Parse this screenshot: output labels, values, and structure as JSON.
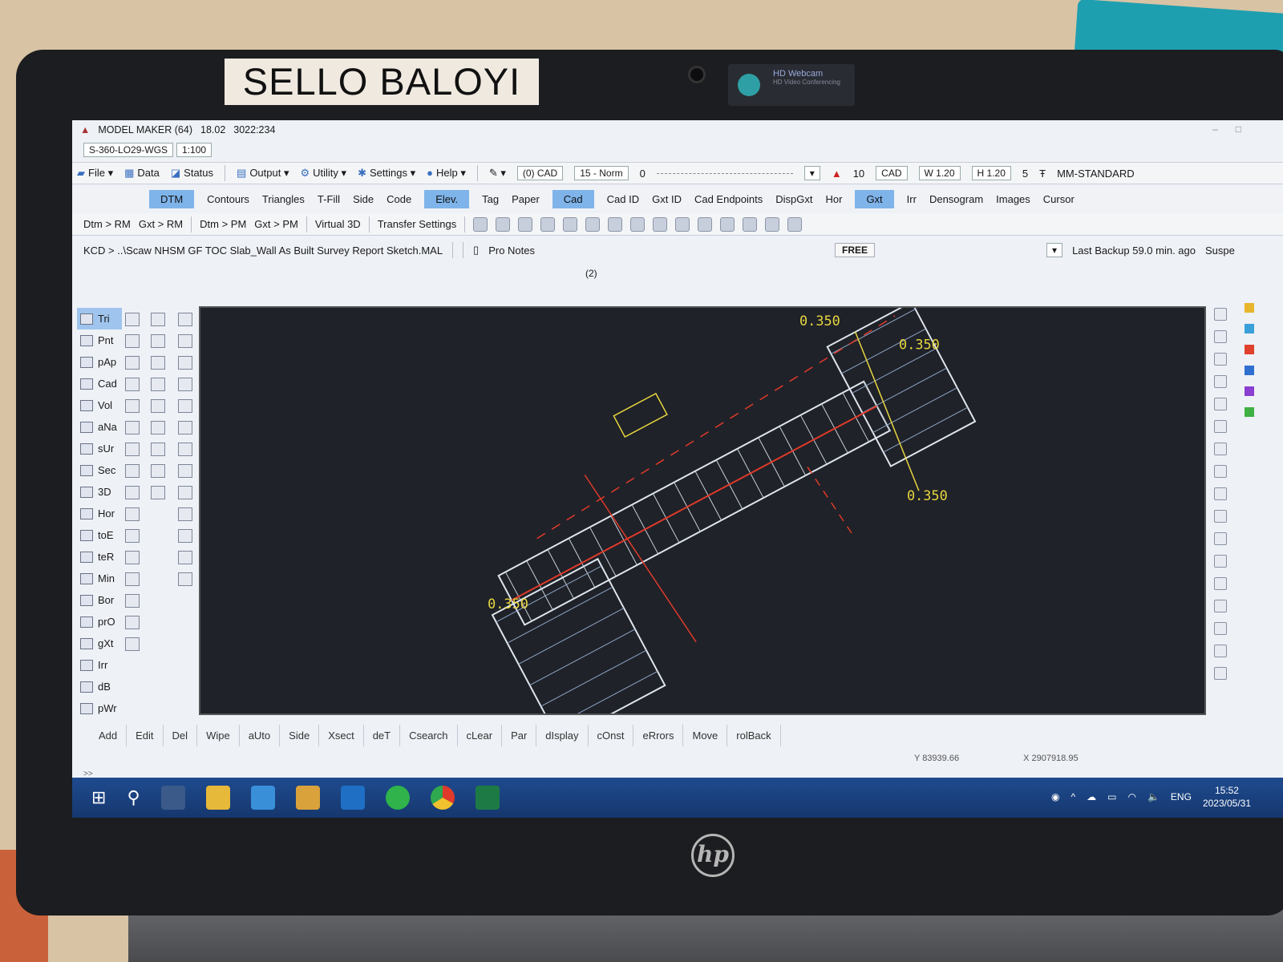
{
  "photo": {
    "name_label": "SELLO BALOYI",
    "webcam_title": "HD Webcam",
    "webcam_subtitle": "HD Video Conferencing",
    "brand": "hp"
  },
  "app": {
    "title": "MODEL MAKER (64)",
    "version": "18.02",
    "build": "3022:234",
    "project": "S-360-LO29-WGS",
    "scale": "1:100"
  },
  "menu": {
    "file": "File",
    "data": "Data",
    "status": "Status",
    "output": "Output",
    "utility": "Utility",
    "settings": "Settings",
    "help": "Help",
    "layer": "(0) CAD",
    "linetype": "15 - Norm",
    "linetype_value": "0",
    "text_size": "10",
    "text_mode": "CAD",
    "width": "W 1.20",
    "height": "H 1.20",
    "count": "5",
    "text_style": "MM-STANDARD"
  },
  "tabs": [
    "DTM",
    "Contours",
    "Triangles",
    "T-Fill",
    "Side",
    "Code",
    "Elev.",
    "Tag",
    "Paper",
    "Cad",
    "Cad ID",
    "Gxt ID",
    "Cad Endpoints",
    "DispGxt",
    "Hor",
    "Gxt",
    "Irr",
    "Densogram",
    "Images",
    "Cursor"
  ],
  "commands": [
    "Dtm > RM",
    "Gxt > RM",
    "Dtm > PM",
    "Gxt > PM",
    "Virtual 3D",
    "Transfer Settings"
  ],
  "path": {
    "file": "KCD > ..\\Scaw NHSM GF TOC Slab_Wall As Built Survey Report Sketch.MAL",
    "notes": "Pro Notes",
    "mode": "FREE",
    "backup": "Last Backup 59.0 min. ago",
    "status": "Suspe",
    "page": "(2)"
  },
  "left_tools": [
    "Tri",
    "Pnt",
    "pAp",
    "Cad",
    "Vol",
    "aNa",
    "sUr",
    "Sec",
    "3D",
    "Hor",
    "toE",
    "teR",
    "Min",
    "Bor",
    "prO",
    "gXt",
    "Irr",
    "dB",
    "pWr"
  ],
  "drawing_labels": [
    "0.350",
    "0.350",
    "0.350",
    "0.350"
  ],
  "command_line": [
    "Add",
    "Edit",
    "Del",
    "Wipe",
    "aUto",
    "Side",
    "Xsect",
    "deT",
    "Csearch",
    "cLear",
    "Par",
    "dIsplay",
    "cOnst",
    "eRrors",
    "Move",
    "rolBack"
  ],
  "coords": {
    "y": "Y 83939.66",
    "x": "X 2907918.95"
  },
  "prompt": ">>",
  "taskbar": {
    "lang": "ENG",
    "time": "15:52",
    "date": "2023/05/31"
  },
  "colors": {
    "accent_tab": "#7fb4ea",
    "canvas_bg": "#1f2228",
    "dimension": "#e8d640",
    "section_line": "#e03a2a",
    "taskbar": "#1e4b8f"
  }
}
